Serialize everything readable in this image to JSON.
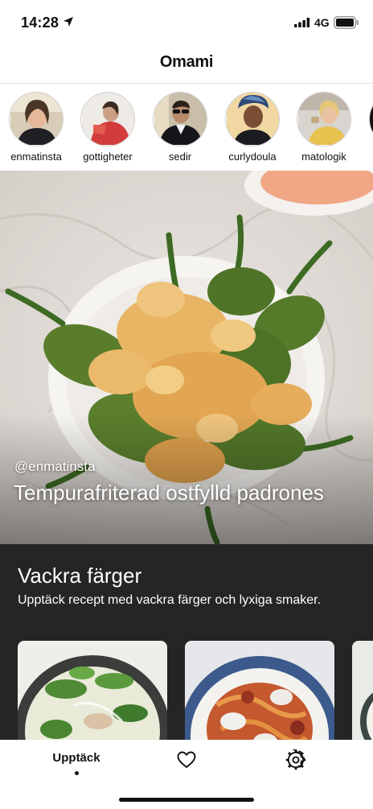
{
  "status_bar": {
    "time": "14:28",
    "network": "4G"
  },
  "header": {
    "title": "Omami"
  },
  "stories": [
    {
      "name": "enmatinsta"
    },
    {
      "name": "gottigheter"
    },
    {
      "name": "sedir"
    },
    {
      "name": "curlydoula"
    },
    {
      "name": "matologik"
    }
  ],
  "hero": {
    "handle": "@enmatinsta",
    "title": "Tempurafriterad ostfylld padrones"
  },
  "collection": {
    "title": "Vackra färger",
    "description": "Upptäck recept med vackra färger och lyxiga smaker."
  },
  "tab_bar": {
    "discover_label": "Upptäck",
    "favorites_icon": "heart-icon",
    "settings_icon": "gear-icon"
  },
  "colors": {
    "collection_background": "#252525",
    "text": "#111111",
    "background": "#ffffff"
  }
}
